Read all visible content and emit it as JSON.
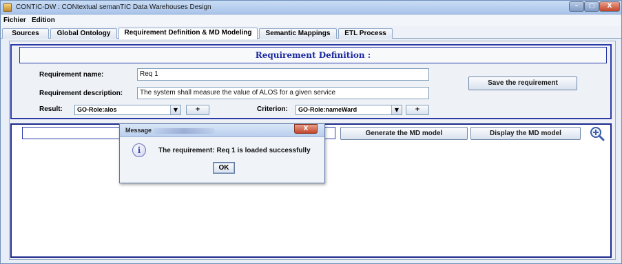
{
  "window": {
    "title": "CONTIC-DW : CONtextual semanTIC Data Warehouses Design",
    "controls": {
      "minimize": "–",
      "maximize": "□",
      "close": "X"
    }
  },
  "menubar": {
    "items": [
      {
        "label": "Fichier"
      },
      {
        "label": "Edition"
      }
    ]
  },
  "tabs": [
    {
      "label": "Sources",
      "active": false
    },
    {
      "label": "Global Ontology",
      "active": false
    },
    {
      "label": "Requirement Definition & MD Modeling",
      "active": true
    },
    {
      "label": "Semantic Mappings",
      "active": false
    },
    {
      "label": "ETL Process",
      "active": false
    }
  ],
  "requirement": {
    "header": "Requirement Definition :",
    "name_label": "Requirement name:",
    "name_value": "Req 1",
    "description_label": "Requirement description:",
    "description_value": "The system shall measure the value of ALOS for a given service",
    "save_button": "Save the requirement",
    "result_label": "Result:",
    "result_value": "GO-Role:alos",
    "criterion_label": "Criterion:",
    "criterion_value": "GO-Role:nameWard",
    "plus_label": "+"
  },
  "md": {
    "generate_button": "Generate the MD model",
    "display_button": "Display the MD model",
    "zoom_icon": "zoom-in-icon"
  },
  "dialog": {
    "title": "Message",
    "close": "X",
    "icon": "info-icon",
    "message": "The requirement: Req 1  is loaded successfully",
    "ok": "OK"
  },
  "colors": {
    "panel_border": "#2a3aa8",
    "header_text": "#1c2aa0",
    "window_background": "#e8eef7"
  }
}
